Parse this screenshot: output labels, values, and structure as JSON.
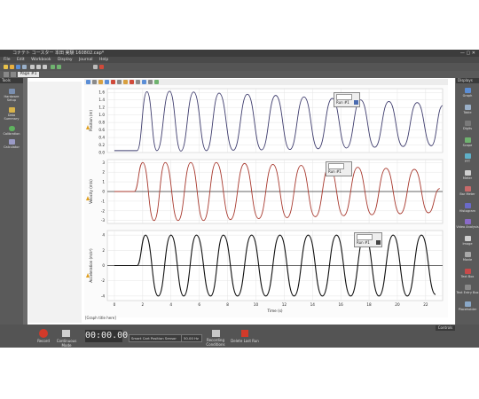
{
  "window": {
    "title": "コナテト コースター 本田 実験 160802.cap*"
  },
  "menu": [
    "File",
    "Edit",
    "Workbook",
    "Display",
    "Journal",
    "Help"
  ],
  "tab": {
    "label": "Page #1"
  },
  "tools_panel": {
    "title": "Tools",
    "items": [
      {
        "label": "Hardware Setup",
        "icon": "hardware-icon"
      },
      {
        "label": "Data Summary",
        "icon": "data-summary-icon"
      },
      {
        "label": "Calibration",
        "icon": "calibration-icon"
      },
      {
        "label": "Calculator",
        "icon": "calculator-icon"
      }
    ]
  },
  "displays_panel": {
    "title": "Displays",
    "items": [
      {
        "label": "Graph",
        "icon": "graph-icon"
      },
      {
        "label": "Table",
        "icon": "table-icon"
      },
      {
        "label": "Digits",
        "icon": "digits-icon"
      },
      {
        "label": "Scope",
        "icon": "scope-icon"
      },
      {
        "label": "FFT",
        "icon": "fft-icon"
      },
      {
        "label": "Meter",
        "icon": "meter-icon"
      },
      {
        "label": "Bar Meter",
        "icon": "bar-meter-icon"
      },
      {
        "label": "Histogram",
        "icon": "histogram-icon"
      },
      {
        "label": "Video Analysis",
        "icon": "video-icon"
      },
      {
        "label": "Image",
        "icon": "image-icon"
      },
      {
        "label": "Movie",
        "icon": "movie-icon"
      },
      {
        "label": "Text Box",
        "icon": "text-box-icon"
      },
      {
        "label": "Text Entry Box",
        "icon": "text-entry-icon"
      },
      {
        "label": "Placeholder",
        "icon": "placeholder-icon"
      }
    ]
  },
  "graph": {
    "footer": "[Graph title here]",
    "legend_run": "Run #1"
  },
  "controls": {
    "title": "Controls",
    "record_label": "Record",
    "mode_label": "Continuous Mode",
    "timer": "00:00.00",
    "sensor": "Smart Cart Position Sensor",
    "rate": "50.00 Hz",
    "recording_conditions": "Recording Conditions",
    "delete_last_run": "Delete Last Run"
  },
  "colors": {
    "position": "#3f3d6e",
    "velocity": "#a8392e",
    "acceleration": "#111111"
  },
  "chart_data": [
    {
      "type": "line",
      "ylabel": "Position (m)",
      "xlabel": "",
      "ylim": [
        0,
        1.7
      ],
      "yticks": [
        0.0,
        0.2,
        0.4,
        0.6,
        0.8,
        1.0,
        1.2,
        1.4,
        1.6
      ],
      "xlim": [
        -0.5,
        23.2
      ],
      "series": [
        {
          "name": "Run #1",
          "color": "#3f3d6e",
          "x": [
            0,
            1.6,
            2.3,
            3.0,
            3.9,
            4.7,
            5.6,
            6.5,
            7.4,
            8.4,
            9.4,
            10.4,
            11.4,
            12.4,
            13.4,
            14.4,
            15.4,
            16.4,
            17.4,
            18.4,
            19.4,
            20.4,
            21.4,
            22.4,
            23.2
          ],
          "y": [
            0.05,
            0.05,
            1.62,
            0.05,
            1.63,
            0.04,
            1.61,
            0.05,
            1.58,
            0.06,
            1.55,
            0.07,
            1.52,
            0.08,
            1.48,
            0.1,
            1.44,
            0.12,
            1.4,
            0.14,
            1.36,
            0.16,
            1.33,
            0.18,
            1.25
          ]
        }
      ]
    },
    {
      "type": "line",
      "ylabel": "Velocity (m/s)",
      "xlabel": "",
      "ylim": [
        -3.3,
        3.3
      ],
      "yticks": [
        -3,
        -2,
        -1,
        0,
        1,
        2,
        3
      ],
      "xlim": [
        -0.5,
        23.2
      ],
      "series": [
        {
          "name": "Run #1",
          "color": "#a8392e",
          "x": [
            0,
            1.4,
            2.0,
            2.8,
            3.6,
            4.5,
            5.4,
            6.3,
            7.2,
            8.2,
            9.2,
            10.2,
            11.2,
            12.2,
            13.2,
            14.2,
            15.2,
            16.2,
            17.2,
            18.2,
            19.2,
            20.2,
            21.2,
            22.2,
            23.0
          ],
          "y": [
            0,
            0,
            3.0,
            -3.0,
            3.0,
            -3.0,
            3.0,
            -3.0,
            3.0,
            -2.9,
            2.9,
            -2.8,
            2.8,
            -2.7,
            2.7,
            -2.6,
            2.6,
            -2.5,
            2.5,
            -2.4,
            2.4,
            -2.3,
            2.3,
            -2.2,
            0.3
          ]
        }
      ]
    },
    {
      "type": "line",
      "ylabel": "Acceleration (m/s²)",
      "xlabel": "Time (s)",
      "ylim": [
        -4.6,
        4.6
      ],
      "yticks": [
        -4,
        -2,
        0,
        2,
        4
      ],
      "xlim": [
        -0.5,
        23.2
      ],
      "xticks": [
        0,
        2,
        4,
        6,
        8,
        10,
        12,
        14,
        16,
        18,
        20,
        22
      ],
      "series": [
        {
          "name": "Run #1",
          "color": "#111111",
          "x": [
            0,
            1.6,
            2.2,
            3.1,
            4.0,
            4.9,
            5.8,
            6.8,
            7.7,
            8.7,
            9.7,
            10.7,
            11.7,
            12.7,
            13.7,
            14.7,
            15.7,
            16.7,
            17.7,
            18.7,
            19.7,
            20.7,
            21.7,
            22.7
          ],
          "y": [
            0,
            0,
            4.0,
            -4.0,
            4.0,
            -4.0,
            4.0,
            -4.0,
            4.0,
            -4.0,
            4.0,
            -4.0,
            4.0,
            -4.0,
            4.0,
            -4.0,
            4.0,
            -4.0,
            4.0,
            -4.0,
            4.0,
            -4.0,
            4.0,
            -3.8
          ]
        }
      ]
    }
  ]
}
